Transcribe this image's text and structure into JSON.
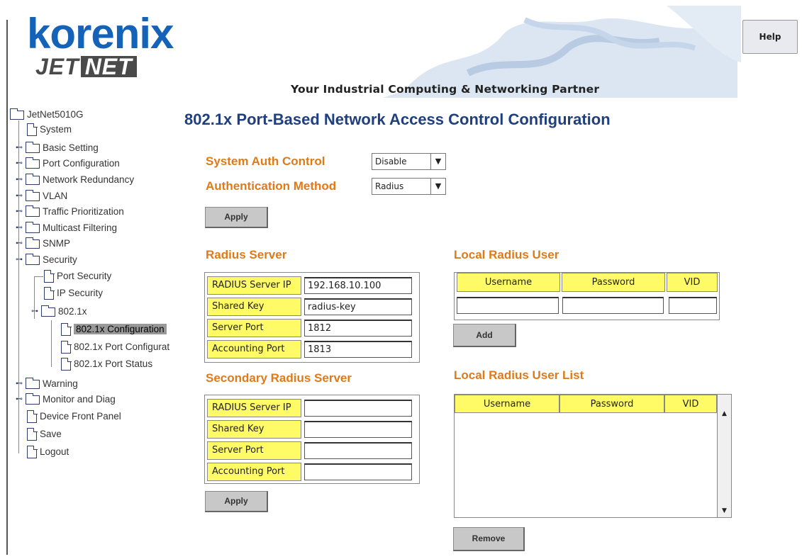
{
  "header": {
    "brand": "korenix",
    "brand_sub_1": "JET",
    "brand_sub_2": "NET",
    "tagline": "Your Industrial Computing & Networking Partner",
    "help_label": "Help"
  },
  "tree": {
    "root": "JetNet5010G",
    "items": [
      {
        "label": "System",
        "type": "file",
        "expanded": false
      },
      {
        "label": "Basic Setting",
        "type": "folder"
      },
      {
        "label": "Port Configuration",
        "type": "folder"
      },
      {
        "label": "Network Redundancy",
        "type": "folder"
      },
      {
        "label": "VLAN",
        "type": "folder"
      },
      {
        "label": "Traffic Prioritization",
        "type": "folder"
      },
      {
        "label": "Multicast Filtering",
        "type": "folder"
      },
      {
        "label": "SNMP",
        "type": "folder"
      },
      {
        "label": "Security",
        "type": "folder",
        "expanded": true
      },
      {
        "label": "Port Security",
        "type": "file"
      },
      {
        "label": "IP Security",
        "type": "file"
      },
      {
        "label": "802.1x",
        "type": "folder",
        "expanded": true
      },
      {
        "label": "802.1x Configuration",
        "type": "file",
        "selected": true
      },
      {
        "label": "802.1x Port Configurat",
        "type": "file"
      },
      {
        "label": "802.1x Port Status",
        "type": "file"
      },
      {
        "label": "Warning",
        "type": "folder"
      },
      {
        "label": "Monitor and Diag",
        "type": "folder"
      },
      {
        "label": "Device Front Panel",
        "type": "file"
      },
      {
        "label": "Save",
        "type": "file"
      },
      {
        "label": "Logout",
        "type": "file"
      }
    ]
  },
  "main": {
    "title": "802.1x Port-Based Network Access Control Configuration",
    "system_auth_control_label": "System Auth Control",
    "system_auth_control_value": "Disable",
    "auth_method_label": "Authentication Method",
    "auth_method_value": "Radius",
    "apply_label": "Apply",
    "radius_server": {
      "heading": "Radius Server",
      "rows": [
        {
          "key": "RADIUS Server IP",
          "value": "192.168.10.100"
        },
        {
          "key": "Shared Key",
          "value": "radius-key"
        },
        {
          "key": "Server Port",
          "value": "1812"
        },
        {
          "key": "Accounting Port",
          "value": "1813"
        }
      ]
    },
    "secondary_radius_server": {
      "heading": "Secondary Radius Server",
      "rows": [
        {
          "key": "RADIUS Server IP",
          "value": ""
        },
        {
          "key": "Shared Key",
          "value": ""
        },
        {
          "key": "Server Port",
          "value": ""
        },
        {
          "key": "Accounting Port",
          "value": ""
        }
      ],
      "apply_label": "Apply"
    },
    "local_radius_user": {
      "heading": "Local Radius User",
      "columns": [
        "Username",
        "Password",
        "VID"
      ],
      "add_label": "Add"
    },
    "local_radius_user_list": {
      "heading": "Local Radius User List",
      "columns": [
        "Username",
        "Password",
        "VID"
      ],
      "remove_label": "Remove"
    }
  },
  "colors": {
    "accent_orange": "#e07a18",
    "title_blue": "#1f3f7f",
    "brand_blue": "#1563b9",
    "label_yellow": "#fffb66"
  }
}
